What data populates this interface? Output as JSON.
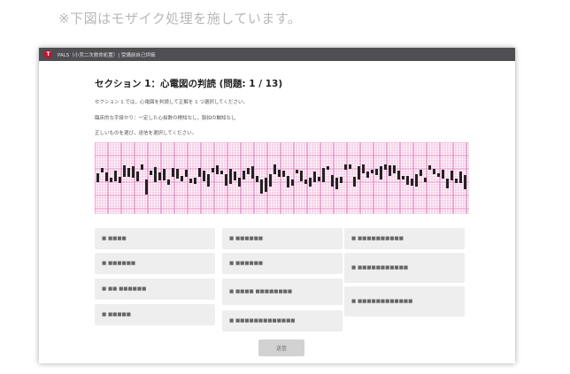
{
  "notice": "※下図はモザイク処理を施しています。",
  "window": {
    "logo_glyph": "T",
    "title": "PALS（小児二次救命処置）| 受講前自己評価"
  },
  "question": {
    "heading": "セクション 1：心電図の判読 (問題: 1 / 13)",
    "lines": [
      "セクション 1 では，心電図を判読して正解を 1 つ選択してください。",
      "臨床的な手掛かり：一定した心拍数の検知なし，脈拍の触知なし",
      "正しいものを選び，送信を選択してください。"
    ]
  },
  "ecg_colors": {
    "grid": "#e36fb7",
    "trace": "#222222",
    "background": "#ffffff"
  },
  "options": [
    {
      "label": "■ ■■■■"
    },
    {
      "label": "■ ■■■■■■"
    },
    {
      "label": "■ ■■ ■■■■■■"
    },
    {
      "label": "■ ■■■■■"
    },
    {
      "label": "■ ■■■■■■"
    },
    {
      "label": "■ ■■■■■■"
    },
    {
      "label": "■ ■■■■ ■■■■■■■■"
    },
    {
      "label": "■ ■■■■■■■■■■■■■"
    },
    {
      "label": "■ ■■■■■■■■■■"
    },
    {
      "label": "■ ■■■■■■■■■■■"
    },
    {
      "label": "■ ■■■■■■■■■■■■"
    }
  ],
  "submit_label": "送信"
}
